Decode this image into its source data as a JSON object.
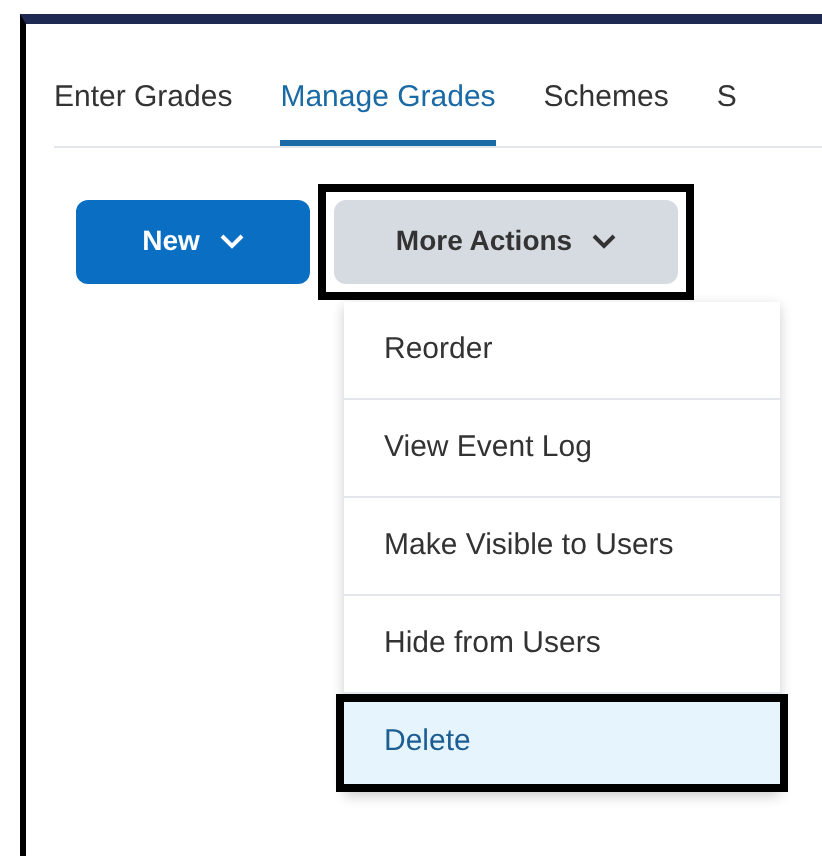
{
  "tabs": [
    {
      "label": "Enter Grades",
      "selected": false
    },
    {
      "label": "Manage Grades",
      "selected": true
    },
    {
      "label": "Schemes",
      "selected": false
    },
    {
      "label": "S",
      "selected": false
    }
  ],
  "buttons": [
    {
      "label": "New",
      "kind": "primary"
    },
    {
      "label": "More Actions",
      "kind": "secondary"
    }
  ],
  "menu": {
    "items": [
      {
        "label": "Reorder",
        "selected": false
      },
      {
        "label": "View Event Log",
        "selected": false
      },
      {
        "label": "Make Visible to Users",
        "selected": false
      },
      {
        "label": "Hide from Users",
        "selected": false
      },
      {
        "label": "Delete",
        "selected": true
      }
    ]
  }
}
